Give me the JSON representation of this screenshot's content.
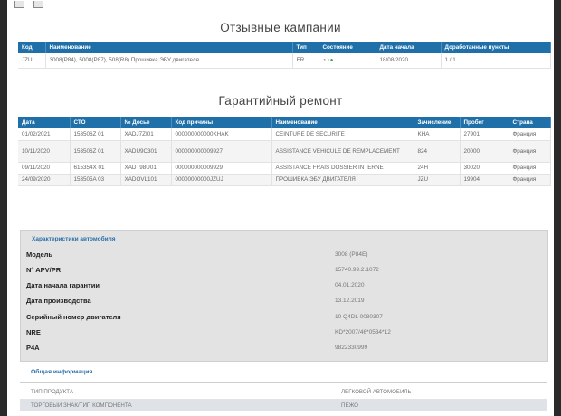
{
  "recall": {
    "title": "Отзывные кампании",
    "headers": [
      "Код",
      "Наименование",
      "Тип",
      "Состояние",
      "Дата начала",
      "Доработанные пункты"
    ],
    "rows": [
      {
        "code": "JZU",
        "name": "3008(P84), 5008(P87), 508(R8) Прошивка ЭБУ двигателя",
        "type": "ER",
        "status_icons": [
          "status-indicator-icon",
          "status-indicator-icon",
          "status-ok-icon"
        ],
        "start": "18/08/2020",
        "points": "1 / 1"
      }
    ]
  },
  "warranty": {
    "title": "Гарантийный ремонт",
    "headers": [
      "Дата",
      "СТО",
      "№ Досье",
      "Код причины",
      "Наименование",
      "Зачисление",
      "Пробег",
      "Страна"
    ],
    "rows": [
      {
        "date": "01/02/2021",
        "sto": "153506Z 01",
        "dossier": "XADJ7ZI01",
        "reason": "000000000000KHAK",
        "name": "CEINTURE DE SECURITE",
        "credit": "KHA",
        "mileage": "27901",
        "country": "Франция"
      },
      {
        "date": "10/11/2020",
        "sto": "153506Z 01",
        "dossier": "XADU9C301",
        "reason": "000000000009927",
        "name": "ASSISTANCE VEHICULE DE REMPLACEMENT",
        "credit": "824",
        "mileage": "20000",
        "country": "Франция"
      },
      {
        "date": "09/11/2020",
        "sto": "615354X 01",
        "dossier": "XADT98U01",
        "reason": "000000000009929",
        "name": "ASSISTANCE FRAIS DOSSIER INTERNE",
        "credit": "24H",
        "mileage": "30020",
        "country": "Франция"
      },
      {
        "date": "24/09/2020",
        "sto": "153505A 03",
        "dossier": "XADOVL101",
        "reason": "00000000000JZUJ",
        "name": "ПРОШИВКА ЭБУ ДВИГАТЕЛЯ",
        "credit": "JZU",
        "mileage": "19904",
        "country": "Франция"
      }
    ]
  },
  "vehicle": {
    "header": "Характеристики автомобиля",
    "rows": [
      {
        "label": "Модель",
        "value": "3008 (P84E)"
      },
      {
        "label": "N° APV/PR",
        "value": "15740.99.2.1072"
      },
      {
        "label": "Дата начала гарантии",
        "value": "04.01.2020"
      },
      {
        "label": "Дата производства",
        "value": "13.12.2019"
      },
      {
        "label": "Серийный номер двигателя",
        "value": "10 Q4DL 0080307"
      },
      {
        "label": "NRE",
        "value": "KD*2007/46*0534*12"
      },
      {
        "label": "P4A",
        "value": "9822330999"
      }
    ]
  },
  "general": {
    "header": "Общая информация",
    "rows": [
      {
        "label": "ТИП ПРОДУКТА",
        "value": "ЛЕГКОВОЙ АВТОМОБИЛЬ"
      },
      {
        "label": "ТОРГОВЫЙ ЗНАК/ТИП КОМПОНЕНТА",
        "value": "ПЕЖО"
      }
    ]
  },
  "colors": {
    "accent": "#1f6fa8",
    "status_ok": "#3aa13a"
  }
}
